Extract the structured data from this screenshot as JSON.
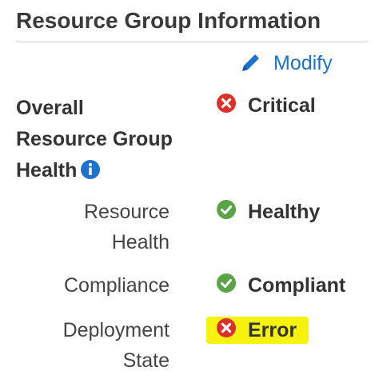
{
  "panel": {
    "title": "Resource Group Information",
    "modify_label": "Modify"
  },
  "overall": {
    "label_line1": "Overall",
    "label_line2": "Resource Group",
    "label_line3": "Health",
    "status": "Critical",
    "status_icon": "error-x-icon",
    "info_icon": "info-icon"
  },
  "rows": {
    "resource_health": {
      "label_line1": "Resource",
      "label_line2": "Health",
      "status": "Healthy",
      "status_icon": "check-icon"
    },
    "compliance": {
      "label": "Compliance",
      "status": "Compliant",
      "status_icon": "check-icon"
    },
    "deployment_state": {
      "label_line1": "Deployment",
      "label_line2": "State",
      "status": "Error",
      "status_icon": "error-x-icon",
      "highlighted": true
    }
  },
  "colors": {
    "accent": "#1e73c8",
    "error": "#d9322b",
    "success": "#5aa447",
    "highlight": "#f7f10f"
  }
}
